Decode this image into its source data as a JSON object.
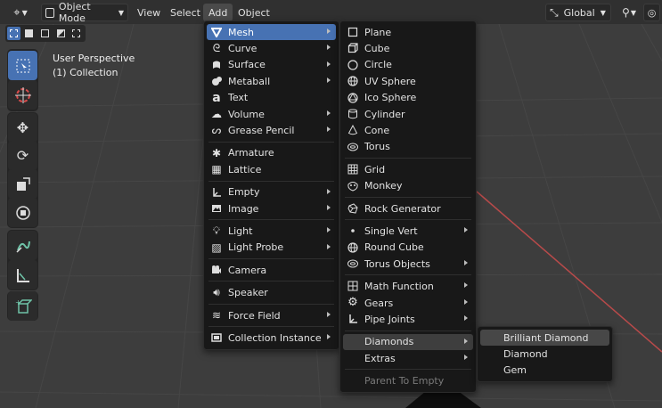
{
  "header": {
    "mode_label": "Object Mode",
    "menus": [
      "View",
      "Select",
      "Add",
      "Object"
    ],
    "orientation_label": "Global"
  },
  "viewport": {
    "perspective_label": "User Perspective",
    "collection_label": "(1) Collection"
  },
  "add_menu": {
    "items": [
      {
        "label": "Mesh",
        "icon": "mesh-icon",
        "submenu": true
      },
      {
        "label": "Curve",
        "icon": "curve-icon",
        "submenu": true
      },
      {
        "label": "Surface",
        "icon": "surface-icon",
        "submenu": true
      },
      {
        "label": "Metaball",
        "icon": "metaball-icon",
        "submenu": true
      },
      {
        "label": "Text",
        "icon": "text-icon",
        "submenu": false
      },
      {
        "label": "Volume",
        "icon": "volume-icon",
        "submenu": true
      },
      {
        "label": "Grease Pencil",
        "icon": "grease-pencil-icon",
        "submenu": true
      },
      {
        "label": "Armature",
        "icon": "armature-icon",
        "submenu": false
      },
      {
        "label": "Lattice",
        "icon": "lattice-icon",
        "submenu": false
      },
      {
        "label": "Empty",
        "icon": "empty-icon",
        "submenu": true
      },
      {
        "label": "Image",
        "icon": "image-icon",
        "submenu": true
      },
      {
        "label": "Light",
        "icon": "light-icon",
        "submenu": true
      },
      {
        "label": "Light Probe",
        "icon": "light-probe-icon",
        "submenu": true
      },
      {
        "label": "Camera",
        "icon": "camera-icon",
        "submenu": false
      },
      {
        "label": "Speaker",
        "icon": "speaker-icon",
        "submenu": false
      },
      {
        "label": "Force Field",
        "icon": "force-field-icon",
        "submenu": true
      },
      {
        "label": "Collection Instance",
        "icon": "collection-instance-icon",
        "submenu": true
      }
    ]
  },
  "mesh_menu": {
    "items": [
      {
        "label": "Plane",
        "icon": "plane-icon"
      },
      {
        "label": "Cube",
        "icon": "cube-icon"
      },
      {
        "label": "Circle",
        "icon": "circle-icon"
      },
      {
        "label": "UV Sphere",
        "icon": "uv-sphere-icon"
      },
      {
        "label": "Ico Sphere",
        "icon": "ico-sphere-icon"
      },
      {
        "label": "Cylinder",
        "icon": "cylinder-icon"
      },
      {
        "label": "Cone",
        "icon": "cone-icon"
      },
      {
        "label": "Torus",
        "icon": "torus-icon"
      },
      {
        "label": "Grid",
        "icon": "grid-icon"
      },
      {
        "label": "Monkey",
        "icon": "monkey-icon"
      },
      {
        "label": "Rock Generator",
        "icon": "rock-generator-icon"
      },
      {
        "label": "Single Vert",
        "icon": "single-vert-icon"
      },
      {
        "label": "Round Cube",
        "icon": "round-cube-icon"
      },
      {
        "label": "Torus Objects",
        "icon": "torus-objects-icon"
      },
      {
        "label": "Math Function",
        "icon": "math-function-icon"
      },
      {
        "label": "Gears",
        "icon": "gears-icon"
      },
      {
        "label": "Pipe Joints",
        "icon": "pipe-joints-icon"
      },
      {
        "label": "Diamonds"
      },
      {
        "label": "Extras"
      },
      {
        "label": "Parent To Empty"
      }
    ]
  },
  "diamonds_menu": {
    "items": [
      {
        "label": "Brilliant Diamond"
      },
      {
        "label": "Diamond"
      },
      {
        "label": "Gem"
      }
    ]
  },
  "colors": {
    "accent": "#4772b3",
    "menu_bg": "#181818",
    "header_bg": "#303030",
    "viewport_bg": "#3d3d3d",
    "axis_red": "#b84a4a"
  }
}
